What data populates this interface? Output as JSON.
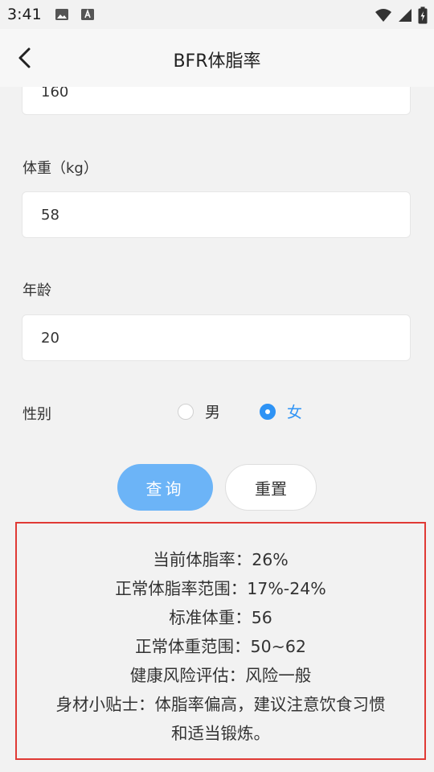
{
  "status_bar": {
    "time": "3:41",
    "left_icons": [
      "image-icon",
      "font-a-icon"
    ],
    "right_icons": [
      "wifi-icon",
      "signal-icon",
      "battery-icon"
    ]
  },
  "app_bar": {
    "title": "BFR体脂率",
    "back_icon": "chevron-left-icon"
  },
  "form": {
    "height_value": "160",
    "weight_label": "体重（kg）",
    "weight_value": "58",
    "age_label": "年龄",
    "age_value": "20",
    "gender_label": "性别",
    "gender_options": [
      {
        "label": "男",
        "checked": false
      },
      {
        "label": "女",
        "checked": true
      }
    ]
  },
  "buttons": {
    "query_label": "查询",
    "reset_label": "重置"
  },
  "result": {
    "lines": [
      "当前体脂率：26%",
      "正常体脂率范围：17%-24%",
      "标准体重：56",
      "正常体重范围：50~62",
      "健康风险评估：风险一般",
      "身材小贴士：体脂率偏高，建议注意饮食习惯",
      "和适当锻炼。"
    ]
  },
  "colors": {
    "accent": "#2e93f5",
    "query_button": "#6cb4f7",
    "result_border": "#e03a35",
    "background": "#f2f2f2"
  }
}
